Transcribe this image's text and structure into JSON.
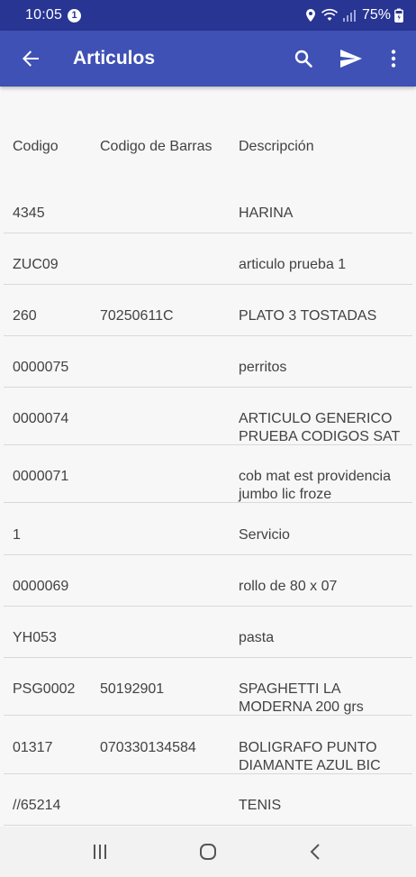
{
  "status_bar": {
    "time": "10:05",
    "notification_count": "1",
    "battery": "75%"
  },
  "app_bar": {
    "title": "Articulos",
    "color": "#3f51b5"
  },
  "table": {
    "headers": [
      "Codigo",
      "Codigo de Barras",
      "Descripción"
    ],
    "rows": [
      {
        "codigo": "4345",
        "barras": "",
        "descripcion": [
          "HARINA"
        ]
      },
      {
        "codigo": "ZUC09",
        "barras": "",
        "descripcion": [
          "articulo prueba 1"
        ]
      },
      {
        "codigo": "260",
        "barras": "70250611C",
        "descripcion": [
          "PLATO 3 TOSTADAS"
        ]
      },
      {
        "codigo": "0000075",
        "barras": "",
        "descripcion": [
          "perritos"
        ]
      },
      {
        "codigo": "0000074",
        "barras": "",
        "descripcion": [
          "ARTICULO GENERICO",
          "PRUEBA CODIGOS SAT"
        ]
      },
      {
        "codigo": "0000071",
        "barras": "",
        "descripcion": [
          "cob mat est providencia",
          "jumbo lic froze"
        ]
      },
      {
        "codigo": "1",
        "barras": "",
        "descripcion": [
          "Servicio"
        ]
      },
      {
        "codigo": "0000069",
        "barras": "",
        "descripcion": [
          "rollo de 80 x 07"
        ]
      },
      {
        "codigo": "YH053",
        "barras": "",
        "descripcion": [
          "pasta"
        ]
      },
      {
        "codigo": "PSG0002",
        "barras": "50192901",
        "descripcion": [
          "SPAGHETTI LA",
          "MODERNA 200 grs"
        ]
      },
      {
        "codigo": "01317",
        "barras": "070330134584",
        "descripcion": [
          "BOLIGRAFO PUNTO",
          "DIAMANTE AZUL BIC"
        ]
      },
      {
        "codigo": "//65214",
        "barras": "",
        "descripcion": [
          "TENIS"
        ]
      }
    ]
  },
  "icons": {
    "back": "arrow-back-icon",
    "search": "search-icon",
    "send": "send-icon",
    "more": "more-vert-icon"
  }
}
